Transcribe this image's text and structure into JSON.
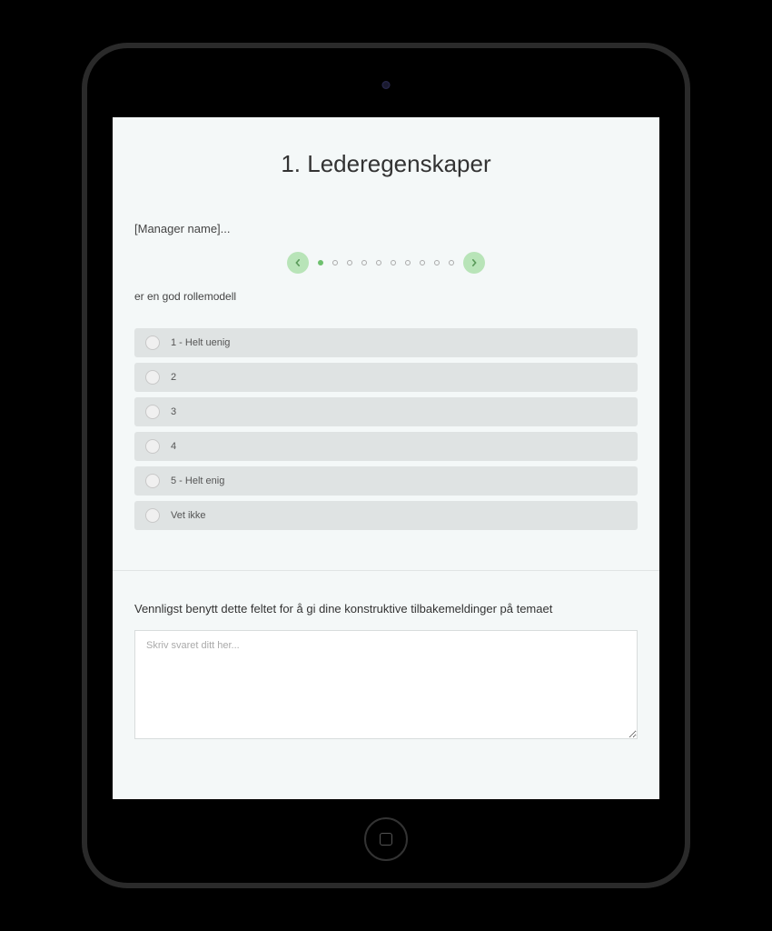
{
  "survey": {
    "title": "1. Lederegenskaper",
    "manager_label": "[Manager name]...",
    "question": "er en god rollemodell",
    "options": [
      {
        "label": "1 - Helt uenig"
      },
      {
        "label": "2"
      },
      {
        "label": "3"
      },
      {
        "label": "4"
      },
      {
        "label": "5 - Helt enig"
      },
      {
        "label": "Vet ikke"
      }
    ],
    "pager": {
      "total": 10,
      "active": 0
    },
    "feedback_prompt": "Vennligst benytt dette feltet for å gi dine konstruktive tilbakemeldinger på temaet",
    "feedback_placeholder": "Skriv svaret ditt her..."
  }
}
